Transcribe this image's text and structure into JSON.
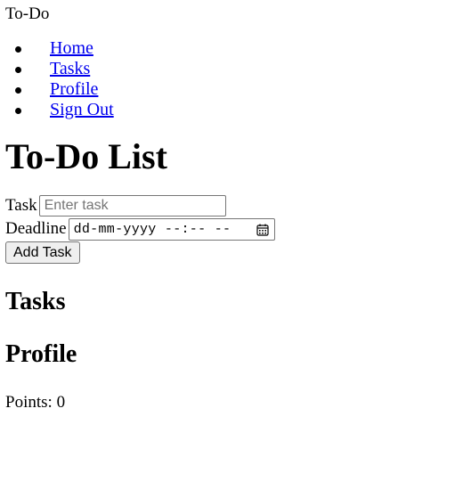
{
  "header": {
    "brand": "To-Do"
  },
  "nav": {
    "items": [
      {
        "label": "Home"
      },
      {
        "label": "Tasks"
      },
      {
        "label": "Profile"
      },
      {
        "label": "Sign Out"
      }
    ]
  },
  "main": {
    "title": "To-Do List",
    "form": {
      "task_label": "Task",
      "task_placeholder": "Enter task",
      "task_value": "",
      "deadline_label": "Deadline",
      "deadline_placeholder": "dd-mm-yyyy --:-- --",
      "calendar_icon": "calendar-icon",
      "submit_label": "Add Task"
    },
    "tasks_heading": "Tasks",
    "profile_heading": "Profile",
    "points_label": "Points:",
    "points_value": "0"
  }
}
